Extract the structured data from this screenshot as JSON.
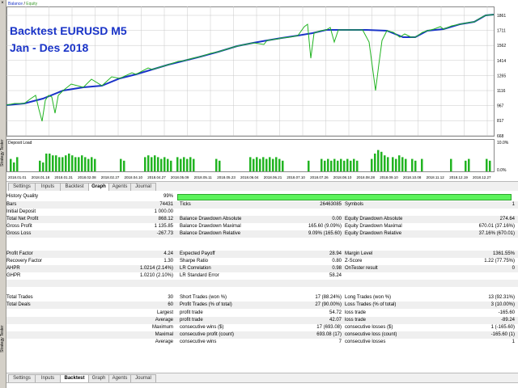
{
  "window": {
    "close_glyph": "×",
    "side_label_top": "Strategy Tester",
    "side_label_bottom": "Strategy Tester"
  },
  "graph": {
    "legend_balance": "Balance",
    "legend_sep": " / ",
    "legend_equity": "Equity",
    "title_line1": "Backtest EURUSD M5",
    "title_line2": "Jan - Des 2018",
    "y_ticks": [
      "1861",
      "1711",
      "1562",
      "1414",
      "1265",
      "1116",
      "967",
      "817",
      "668"
    ],
    "deposit_label": "Deposit Load",
    "deposit_ticks": [
      "10.0%",
      "0.0%"
    ],
    "x_ticks": [
      "2018.01.01",
      "2018.01.18",
      "2018.01.31",
      "2018.02.08",
      "2018.02.27",
      "2018.04.10",
      "2018.04.27",
      "2018.05.09",
      "2018.05.11",
      "2018.05.23",
      "2018.06.04",
      "2018.06.21",
      "2018.07.10",
      "2018.07.26",
      "2018.08.10",
      "2018.08.28",
      "2018.09.10",
      "2018.10.08",
      "2018.11.12",
      "2018.12.19",
      "2018.12.27"
    ],
    "colors": {
      "balance": "#1a34c8",
      "equity": "#22b422",
      "deposit": "#22b422",
      "grid": "#c8c8c8"
    }
  },
  "tabs_top": [
    "Settings",
    "Inputs",
    "Backtest",
    "Graph",
    "Agents",
    "Journal"
  ],
  "tabs_top_active": "Graph",
  "tabs_bottom": [
    "Settings",
    "Inputs",
    "Backtest",
    "Graph",
    "Agents",
    "Journal"
  ],
  "tabs_bottom_active": "Backtest",
  "report": {
    "history_quality_label": "History Quality",
    "history_quality_value": "99%",
    "history_quality_fill": 0.99,
    "rows": [
      {
        "c1l": "Bars",
        "c1v": "74431",
        "c2l": "Ticks",
        "c2v": "26463085",
        "c3l": "Symbols",
        "c3v": "1"
      },
      {
        "c1l": "Initial Deposit",
        "c1v": "1 000.00",
        "c2l": "",
        "c2v": "",
        "c3l": "",
        "c3v": ""
      },
      {
        "c1l": "Total Net Profit",
        "c1v": "868.12",
        "c2l": "Balance Drawdown Absolute",
        "c2v": "0.00",
        "c3l": "Equity Drawdown Absolute",
        "c3v": "274.64"
      },
      {
        "c1l": "Gross Profit",
        "c1v": "1 135.85",
        "c2l": "Balance Drawdown Maximal",
        "c2v": "165.60 (9.09%)",
        "c3l": "Equity Drawdown Maximal",
        "c3v": "670.01 (37.16%)"
      },
      {
        "c1l": "Gross Loss",
        "c1v": "-267.73",
        "c2l": "Balance Drawdown Relative",
        "c2v": "9.09% (165.60)",
        "c3l": "Equity Drawdown Relative",
        "c3v": "37.16% (670.01)"
      },
      {
        "c1l": "",
        "c1v": "",
        "c2l": "",
        "c2v": "",
        "c3l": "",
        "c3v": ""
      },
      {
        "c1l": "Profit Factor",
        "c1v": "4.24",
        "c2l": "Expected Payoff",
        "c2v": "28.94",
        "c3l": "Margin Level",
        "c3v": "1361.55%"
      },
      {
        "c1l": "Recovery Factor",
        "c1v": "1.30",
        "c2l": "Sharpe Ratio",
        "c2v": "0.80",
        "c3l": "Z-Score",
        "c3v": "1.22 (77.75%)"
      },
      {
        "c1l": "AHPR",
        "c1v": "1.0214 (2.14%)",
        "c2l": "LR Correlation",
        "c2v": "0.98",
        "c3l": "OnTester result",
        "c3v": "0"
      },
      {
        "c1l": "GHPR",
        "c1v": "1.0210 (2.10%)",
        "c2l": "LR Standard Error",
        "c2v": "58.24",
        "c3l": "",
        "c3v": ""
      },
      {
        "c1l": "",
        "c1v": "",
        "c2l": "",
        "c2v": "",
        "c3l": "",
        "c3v": ""
      },
      {
        "c1l": "Total Trades",
        "c1v": "30",
        "c2l": "Short Trades (won %)",
        "c2v": "17 (88.24%)",
        "c3l": "Long Trades (won %)",
        "c3v": "13 (92.31%)"
      },
      {
        "c1l": "Total Deals",
        "c1v": "60",
        "c2l": "Profit Trades (% of total)",
        "c2v": "27 (90.00%)",
        "c3l": "Loss Trades (% of total)",
        "c3v": "3 (10.00%)"
      },
      {
        "c1l": "",
        "c1v": "Largest",
        "c2l": "profit trade",
        "c2v": "54.72",
        "c3l": "loss trade",
        "c3v": "-165.60"
      },
      {
        "c1l": "",
        "c1v": "Average",
        "c2l": "profit trade",
        "c2v": "42.07",
        "c3l": "loss trade",
        "c3v": "-89.24"
      },
      {
        "c1l": "",
        "c1v": "Maximum",
        "c2l": "consecutive wins ($)",
        "c2v": "17 (693.08)",
        "c3l": "consecutive losses ($)",
        "c3v": "1 (-165.60)"
      },
      {
        "c1l": "",
        "c1v": "Maximal",
        "c2l": "consecutive profit (count)",
        "c2v": "693.08 (17)",
        "c3l": "consecutive loss (count)",
        "c3v": "-165.60 (1)"
      },
      {
        "c1l": "",
        "c1v": "Average",
        "c2l": "consecutive wins",
        "c2v": "7",
        "c3l": "consecutive losses",
        "c3v": "1"
      }
    ]
  }
}
